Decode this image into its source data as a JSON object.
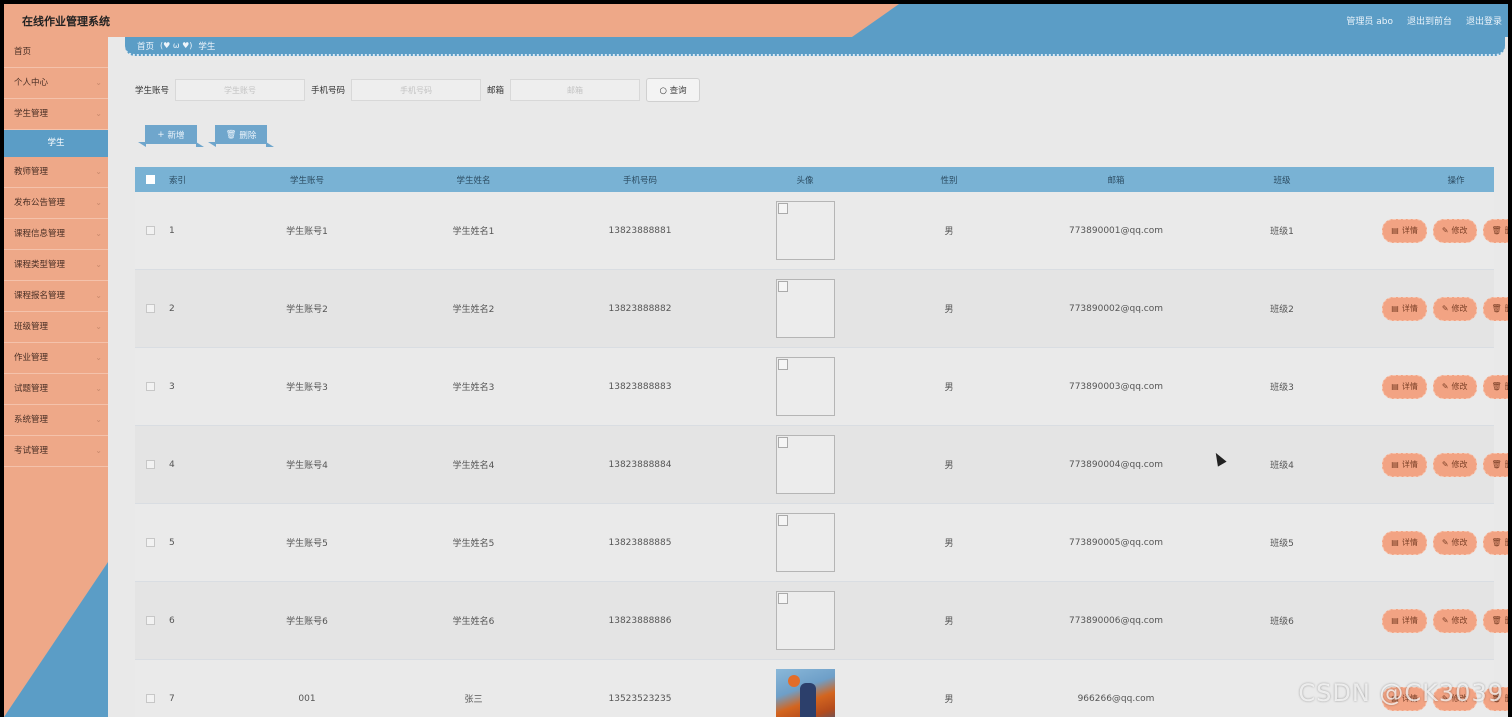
{
  "header": {
    "title": "在线作业管理系统",
    "user_label": "管理员 abo",
    "to_front": "退出到前台",
    "logout": "退出登录"
  },
  "sidebar": {
    "items": [
      {
        "label": "首页",
        "chevron": false
      },
      {
        "label": "个人中心",
        "chevron": true
      },
      {
        "label": "学生管理",
        "chevron": true
      },
      {
        "label": "学生",
        "sub": true
      },
      {
        "label": "教师管理",
        "chevron": true
      },
      {
        "label": "发布公告管理",
        "chevron": true
      },
      {
        "label": "课程信息管理",
        "chevron": true
      },
      {
        "label": "课程类型管理",
        "chevron": true
      },
      {
        "label": "课程报名管理",
        "chevron": true
      },
      {
        "label": "班级管理",
        "chevron": true
      },
      {
        "label": "作业管理",
        "chevron": true
      },
      {
        "label": "试题管理",
        "chevron": true
      },
      {
        "label": "系统管理",
        "chevron": true
      },
      {
        "label": "考试管理",
        "chevron": true
      }
    ]
  },
  "breadcrumb": {
    "home": "首页",
    "face": "(♥ ω ♥)",
    "current": "学生"
  },
  "search": {
    "account_label": "学生账号",
    "account_placeholder": "学生账号",
    "phone_label": "手机号码",
    "phone_placeholder": "手机号码",
    "email_label": "邮箱",
    "email_placeholder": "邮箱",
    "query_button": "查询"
  },
  "actions": {
    "add": "新增",
    "delete": "删除"
  },
  "table": {
    "headers": [
      "索引",
      "学生账号",
      "学生姓名",
      "手机号码",
      "头像",
      "性别",
      "邮箱",
      "班级",
      "操作"
    ],
    "op_labels": {
      "detail": "详情",
      "edit": "修改",
      "delete": "删除"
    },
    "rows": [
      {
        "index": "1",
        "account": "学生账号1",
        "name": "学生姓名1",
        "phone": "13823888881",
        "avatar": "broken",
        "sex": "男",
        "email": "773890001@qq.com",
        "class": "班级1"
      },
      {
        "index": "2",
        "account": "学生账号2",
        "name": "学生姓名2",
        "phone": "13823888882",
        "avatar": "broken",
        "sex": "男",
        "email": "773890002@qq.com",
        "class": "班级2"
      },
      {
        "index": "3",
        "account": "学生账号3",
        "name": "学生姓名3",
        "phone": "13823888883",
        "avatar": "broken",
        "sex": "男",
        "email": "773890003@qq.com",
        "class": "班级3"
      },
      {
        "index": "4",
        "account": "学生账号4",
        "name": "学生姓名4",
        "phone": "13823888884",
        "avatar": "broken",
        "sex": "男",
        "email": "773890004@qq.com",
        "class": "班级4"
      },
      {
        "index": "5",
        "account": "学生账号5",
        "name": "学生姓名5",
        "phone": "13823888885",
        "avatar": "broken",
        "sex": "男",
        "email": "773890005@qq.com",
        "class": "班级5"
      },
      {
        "index": "6",
        "account": "学生账号6",
        "name": "学生姓名6",
        "phone": "13823888886",
        "avatar": "broken",
        "sex": "男",
        "email": "773890006@qq.com",
        "class": "班级6"
      },
      {
        "index": "7",
        "account": "001",
        "name": "张三",
        "phone": "13523523235",
        "avatar": "photo",
        "sex": "男",
        "email": "966266@qq.com",
        "class": ""
      }
    ]
  },
  "watermark": "CSDN @CK3039",
  "colors": {
    "accent_orange": "#eea888",
    "accent_blue": "#5b9dc6",
    "header_row": "#79b2d4"
  }
}
